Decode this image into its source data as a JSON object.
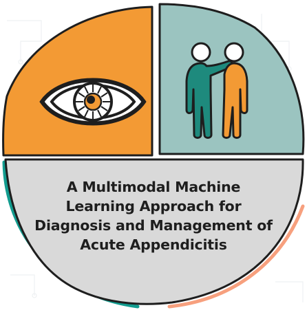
{
  "title_lines": [
    "A Multimodal Machine",
    "Learning Approach for",
    "Diagnosis and Management of",
    "Acute Appendicitis"
  ],
  "icons": {
    "left_quadrant": "eye-icon",
    "right_quadrant": "two-people-shoulder-icon"
  },
  "colors": {
    "orange": "#f39a34",
    "teal": "#9bc4c0",
    "gray": "#d9d9d9",
    "outline": "#1e1e1e",
    "dark_teal": "#129c8f",
    "peach": "#f7a07e",
    "person_left": "#1e8a7d",
    "person_right": "#f39a34"
  }
}
